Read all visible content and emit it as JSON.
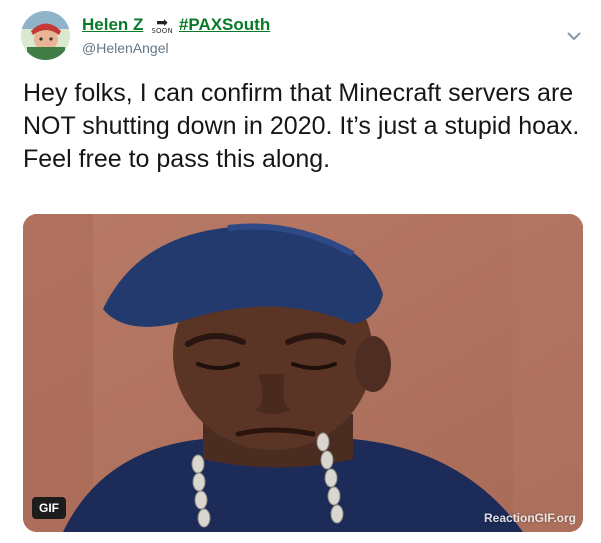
{
  "tweet": {
    "author": {
      "display_name": "Helen Z",
      "badge_text": "SOON",
      "hashtag": "#PAXSouth",
      "handle": "@HelenAngel"
    },
    "text": "Hey folks, I can confirm that Minecraft servers are NOT shutting down in 2020. It’s just a stupid hoax. Feel free to pass this along.",
    "media": {
      "badge": "GIF",
      "watermark": "ReactionGIF.org"
    },
    "icons": {
      "avatar": "user-avatar-icon",
      "caret": "chevron-down-icon",
      "badge_arrow": "arrow-right-icon"
    }
  },
  "colors": {
    "name": "#0a7a2a",
    "text": "#14171a",
    "handle": "#657786",
    "media_background": "#b57863"
  }
}
